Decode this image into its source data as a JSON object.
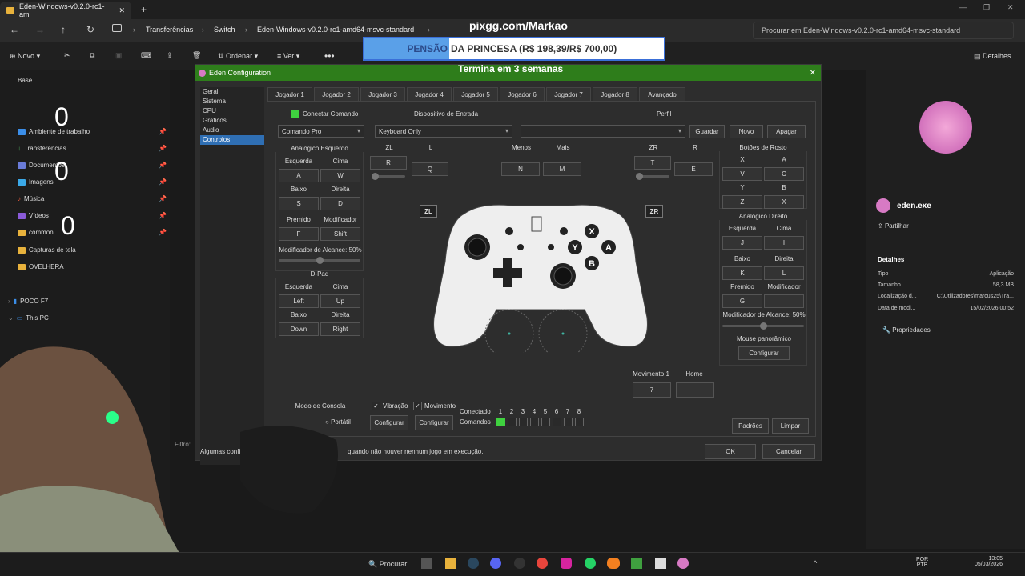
{
  "explorer": {
    "tab_title": "Eden-Windows-v0.2.0-rc1-am",
    "breadcrumb": [
      "Transferências",
      "Switch",
      "Eden-Windows-v0.2.0-rc1-amd64-msvc-standard"
    ],
    "search_placeholder": "Procurar em Eden-Windows-v0.2.0-rc1-amd64-msvc-standard",
    "toolbar": {
      "new": "Novo",
      "sort": "Ordenar",
      "view": "Ver",
      "details": "Detalhes"
    },
    "sidebar": [
      {
        "label": "Base"
      },
      {
        "label": "Ambiente de trabalho"
      },
      {
        "label": "Transferências"
      },
      {
        "label": "Documentos"
      },
      {
        "label": "Imagens"
      },
      {
        "label": "Música"
      },
      {
        "label": "Vídeos"
      },
      {
        "label": "common"
      },
      {
        "label": "Capturas de tela"
      },
      {
        "label": "OVELHERA"
      },
      {
        "label": "POCO F7"
      },
      {
        "label": "This PC"
      }
    ],
    "details": {
      "file_name": "eden.exe",
      "share": "Partilhar",
      "section": "Detalhes",
      "rows": [
        {
          "k": "Tipo",
          "v": "Aplicação"
        },
        {
          "k": "Tamanho",
          "v": "58,3 MB"
        },
        {
          "k": "Localização d...",
          "v": "C:\\Utilizadores\\marcus25\\Tra..."
        },
        {
          "k": "Data de modi...",
          "v": "15/02/2026 00:52"
        }
      ],
      "properties": "Propriedades"
    },
    "filter_label": "Filtro:",
    "counter": "0"
  },
  "overlay": {
    "pixgg": "pixgg.com/Markao",
    "banner_left": "PENSÃO",
    "banner_text": "DA PRINCESA (R$ 198,39/R$ 700,00)",
    "countdown": "Termina em 3 semanas"
  },
  "dialog": {
    "title": "Eden Configuration",
    "categories": [
      "Geral",
      "Sistema",
      "CPU",
      "Gráficos",
      "Audio",
      "Controlos"
    ],
    "player_tabs": [
      "Jogador 1",
      "Jogador 2",
      "Jogador 3",
      "Jogador 4",
      "Jogador 5",
      "Jogador 6",
      "Jogador 7",
      "Jogador 8",
      "Avançado"
    ],
    "connect": "Conectar Comando",
    "input_device_label": "Dispositivo de Entrada",
    "controller_type": "Comando Pro",
    "input_device": "Keyboard Only",
    "profile_label": "Perfil",
    "profile_buttons": [
      "Guardar",
      "Novo",
      "Apagar"
    ],
    "left_stick": {
      "title": "Analógico Esquerdo",
      "left": "Esquerda",
      "up": "Cima",
      "left_key": "A",
      "up_key": "W",
      "down": "Baixo",
      "right": "Direita",
      "down_key": "S",
      "right_key": "D",
      "pressed": "Premido",
      "modifier": "Modificador",
      "pressed_key": "F",
      "modifier_key": "Shift",
      "range": "Modificador de Alcance: 50%"
    },
    "dpad": {
      "title": "D-Pad",
      "left": "Esquerda",
      "up": "Cima",
      "left_key": "Left",
      "up_key": "Up",
      "down": "Baixo",
      "right": "Direita",
      "down_key": "Down",
      "right_key": "Right"
    },
    "shoulders": {
      "zl": "ZL",
      "l": "L",
      "zl_key": "R",
      "l_key": "Q",
      "minus": "Menos",
      "plus": "Mais",
      "minus_key": "N",
      "plus_key": "M",
      "zr": "ZR",
      "r": "R",
      "zr_key": "T",
      "r_key": "E"
    },
    "face": {
      "title": "Botões de Rosto",
      "x": "X",
      "a": "A",
      "x_key": "V",
      "a_key": "C",
      "y": "Y",
      "b": "B",
      "y_key": "Z",
      "b_key": "X"
    },
    "right_stick": {
      "title": "Analógico Direito",
      "left": "Esquerda",
      "up": "Cima",
      "left_key": "J",
      "up_key": "I",
      "down": "Baixo",
      "right": "Direita",
      "down_key": "K",
      "right_key": "L",
      "pressed": "Premido",
      "modifier": "Modificador",
      "pressed_key": "G",
      "range": "Modificador de Alcance: 50%"
    },
    "mouse_pan": "Mouse panorâmico",
    "configure": "Configurar",
    "motion1": "Movimento 1",
    "motion1_key": "7",
    "home": "Home",
    "zl_badge": "ZL",
    "zr_badge": "ZR",
    "console_mode": "Modo de Consola",
    "portable": "Portátil",
    "vibration": "Vibração",
    "motion": "Movimento",
    "connected": "Conectado",
    "controllers": "Comandos",
    "slots": [
      "1",
      "2",
      "3",
      "4",
      "5",
      "6",
      "7",
      "8"
    ],
    "defaults": "Padrões",
    "clear": "Limpar",
    "footer_note": "Algumas configurações",
    "footer_note2": "quando não houver nenhum jogo em execução.",
    "ok": "OK",
    "cancel": "Cancelar",
    "face_glyphs": {
      "x": "X",
      "y": "Y",
      "a": "A",
      "b": "B"
    }
  },
  "taskbar": {
    "search": "Procurar",
    "lang": "POR",
    "layout": "PTB",
    "time": "13:05",
    "date": "05/03/2026"
  }
}
